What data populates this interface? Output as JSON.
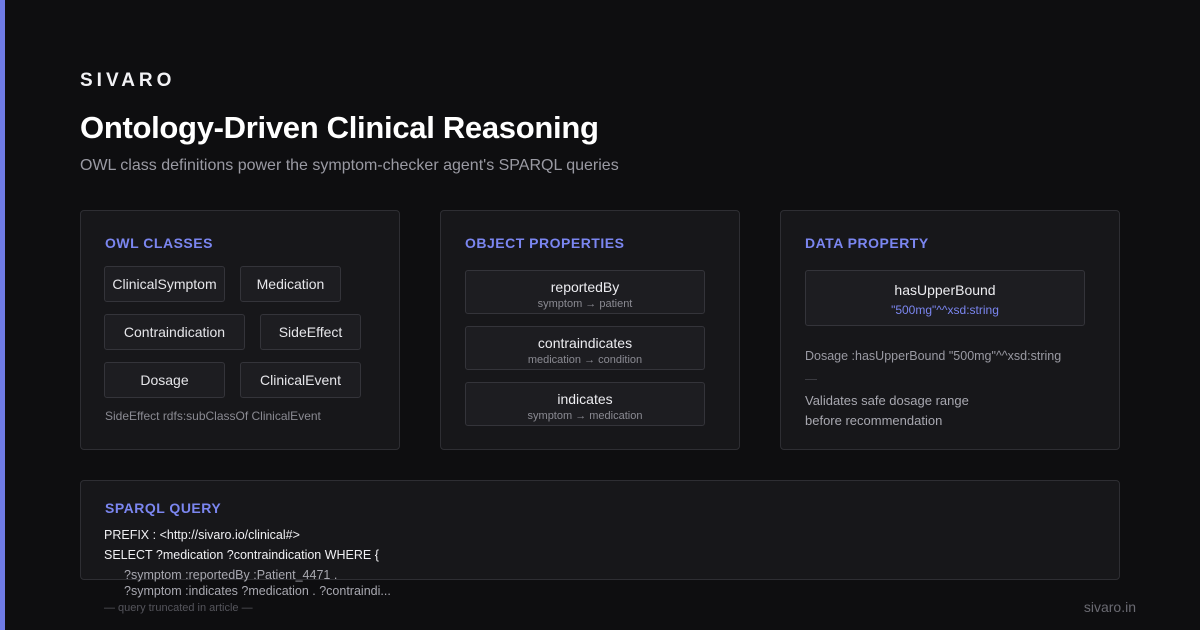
{
  "brand": "SIVARO",
  "title": "Ontology-Driven Clinical Reasoning",
  "subtitle": "OWL class definitions power the symptom-checker agent's SPARQL queries",
  "owl_classes": {
    "heading": "OWL CLASSES",
    "classes": [
      "ClinicalSymptom",
      "Medication",
      "Contraindication",
      "SideEffect",
      "Dosage",
      "ClinicalEvent"
    ],
    "note": "SideEffect rdfs:subClassOf ClinicalEvent"
  },
  "object_properties": {
    "heading": "OBJECT PROPERTIES",
    "items": [
      {
        "name": "reportedBy",
        "signature": "symptom → patient"
      },
      {
        "name": "contraindicates",
        "signature": "medication → condition"
      },
      {
        "name": "indicates",
        "signature": "symptom → medication"
      }
    ]
  },
  "data_property": {
    "heading": "DATA PROPERTY",
    "name": "hasUpperBound",
    "value": "\"500mg\"^^xsd:string",
    "example": "Dosage :hasUpperBound \"500mg\"^^xsd:string",
    "description_line1": "Validates safe dosage range",
    "description_line2": "before recommendation"
  },
  "sparql": {
    "heading": "SPARQL QUERY",
    "lines": [
      "PREFIX : <http://sivaro.io/clinical#>",
      "SELECT ?medication ?contraindication WHERE {",
      "?symptom :reportedBy :Patient_4471 .",
      "?symptom :indicates ?medication . ?contraindi..."
    ],
    "truncation_note": "— query truncated in article —"
  },
  "site": "sivaro.in",
  "colors": {
    "accent": "#6f7be6",
    "background": "#0e0e10",
    "card": "#17171a"
  }
}
